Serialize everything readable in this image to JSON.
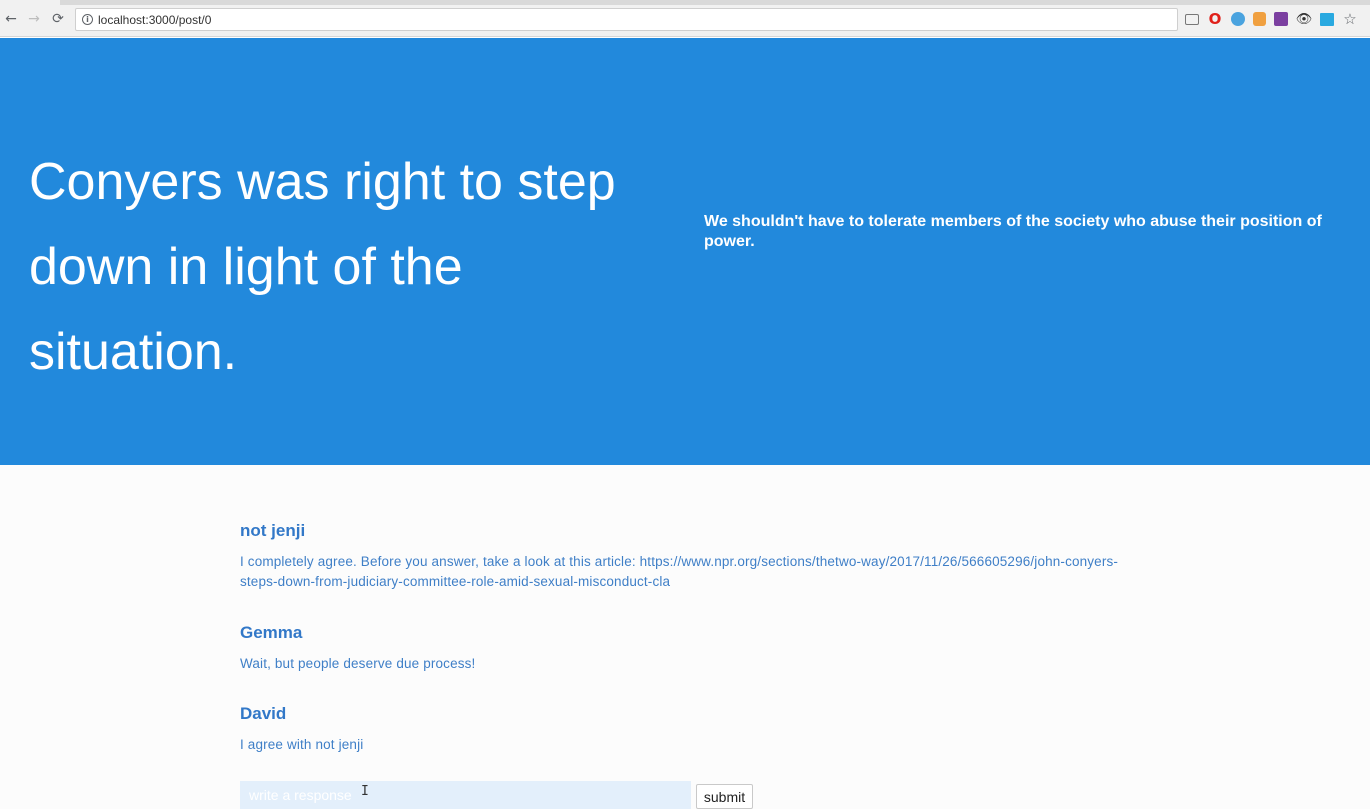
{
  "browser": {
    "url": "localhost:3000/post/0",
    "back_glyph": "←",
    "forward_glyph": "→",
    "reload_glyph": "⟳",
    "info_glyph": "i",
    "star_glyph": "☆",
    "opera_glyph": "O",
    "eye_glyph": "👁",
    "extensions": [
      "cast-icon",
      "opera-icon",
      "blue-extension-icon",
      "orange-extension-icon",
      "purple-extension-icon",
      "eye-icon",
      "grid-extension-icon",
      "bookmark-star-icon"
    ]
  },
  "post": {
    "title": "Conyers was right to step down in light of the situation.",
    "description": "We shouldn't have to tolerate members of the society who abuse their position of power."
  },
  "comments": [
    {
      "author": "not jenji",
      "body": "I completely agree. Before you answer, take a look at this article: https://www.npr.org/sections/thetwo-way/2017/11/26/566605296/john-conyers-steps-down-from-judiciary-committee-role-amid-sexual-misconduct-cla"
    },
    {
      "author": "Gemma",
      "body": "Wait, but people deserve due process!"
    },
    {
      "author": "David",
      "body": "I agree with not jenji"
    }
  ],
  "response_form": {
    "placeholder": "write a response",
    "submit_label": "submit",
    "cursor_glyph": "I"
  },
  "colors": {
    "hero_bg": "#2289dc",
    "author": "#3278c8",
    "comment_body": "#3f7fc7"
  }
}
